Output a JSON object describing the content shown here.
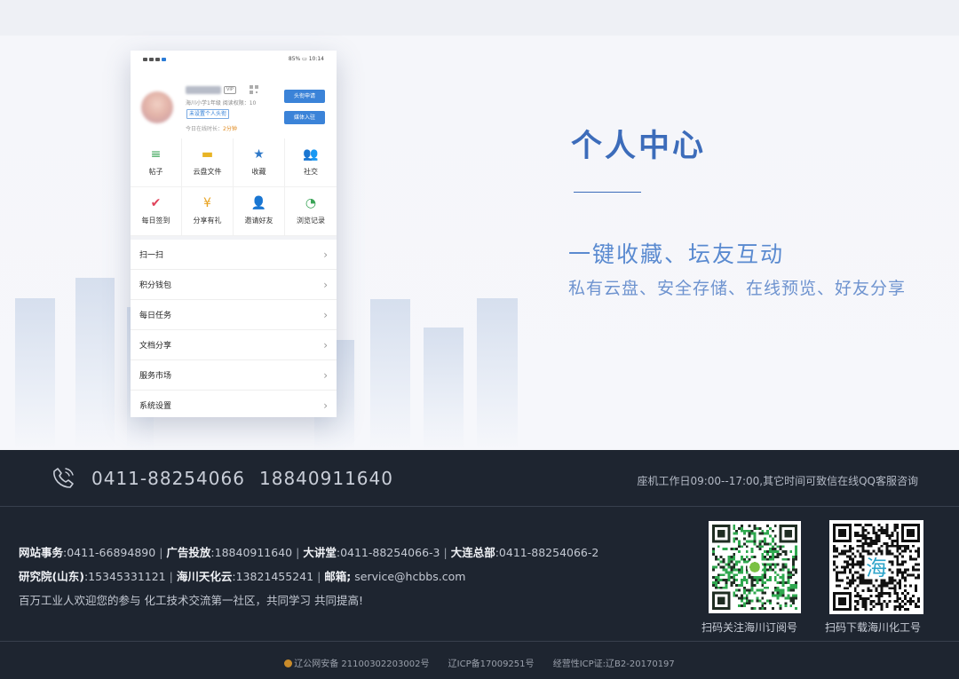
{
  "phone": {
    "status_right": "85% ▭ 10:14",
    "vip": "VIP",
    "school": "海川小学1年级  阅读权限：10",
    "signature_btn": "未设置个人头衔",
    "online_prefix": "今日在线时长：",
    "online_value": "2分钟",
    "btn_apply": "头衔申请",
    "btn_media": "媒体入驻",
    "grid": [
      {
        "label": "帖子",
        "icon": "≡",
        "icon_name": "post-list-icon",
        "color": "#3aa457"
      },
      {
        "label": "云盘文件",
        "icon": "▬",
        "icon_name": "folder-icon",
        "color": "#e8b425"
      },
      {
        "label": "收藏",
        "icon": "★",
        "icon_name": "star-icon",
        "color": "#2e78c8"
      },
      {
        "label": "社交",
        "icon": "👥",
        "icon_name": "users-icon",
        "color": "#e0425a"
      },
      {
        "label": "每日签到",
        "icon": "✔",
        "icon_name": "calendar-check-icon",
        "color": "#e0425a"
      },
      {
        "label": "分享有礼",
        "icon": "¥",
        "icon_name": "coin-icon",
        "color": "#e8a21f"
      },
      {
        "label": "邀请好友",
        "icon": "👤",
        "icon_name": "add-friend-icon",
        "color": "#e8a21f"
      },
      {
        "label": "浏览记录",
        "icon": "◔",
        "icon_name": "clock-icon",
        "color": "#3aa457"
      }
    ],
    "menu": [
      "扫一扫",
      "积分钱包",
      "每日任务",
      "文档分享",
      "服务市场",
      "系统设置"
    ]
  },
  "hero": {
    "title": "个人中心",
    "subtitle": "一键收藏、坛友互动",
    "description": "私有云盘、安全存储、在线预览、好友分享"
  },
  "footer": {
    "phone1": "0411-88254066",
    "phone2": "18840911640",
    "hours": "座机工作日09:00--17:00,其它时间可致信在线QQ客服咨询",
    "contacts": [
      [
        {
          "k": "网站事务",
          "v": ":0411-66894890"
        },
        {
          "k": "广告投放",
          "v": ":18840911640"
        },
        {
          "k": "大讲堂",
          "v": ":0411-88254066-3"
        },
        {
          "k": "大连总部",
          "v": ":0411-88254066-2"
        }
      ],
      [
        {
          "k": "研究院(山东)",
          "v": ":15345331121"
        },
        {
          "k": "海川天化云",
          "v": ":13821455241"
        },
        {
          "k": "邮箱;",
          "v": " service@hcbbs.com"
        }
      ]
    ],
    "slogan": "百万工业人欢迎您的参与 化工技术交流第一社区，共同学习 共同提高!",
    "qr1_caption": "扫码关注海川订阅号",
    "qr2_caption": "扫码下载海川化工号",
    "qr2_center": "海",
    "icp1": "辽公网安备 21100302203002号",
    "icp2": "辽ICP备17009251号",
    "icp3": "经营性ICP证:辽B2-20170197"
  }
}
